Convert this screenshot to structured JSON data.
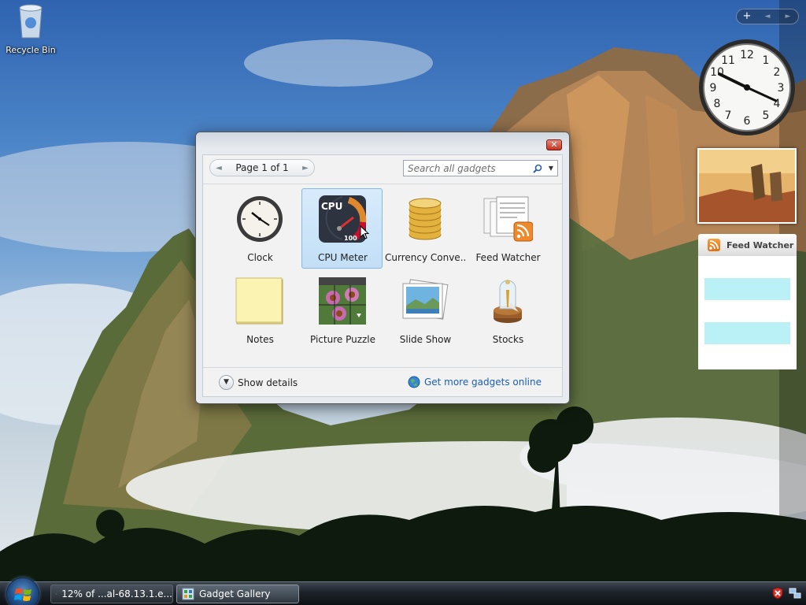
{
  "desktop": {
    "recycle_bin_label": "Recycle Bin"
  },
  "sidebar": {
    "controls": {
      "add_label": "+",
      "prev_label": "◄",
      "next_label": "►"
    },
    "feed_watcher": {
      "title": "Feed Watcher"
    }
  },
  "gallery": {
    "close_label": "✕",
    "pager": {
      "label": "Page 1 of 1",
      "prev_icon": "◄",
      "next_icon": "►"
    },
    "search": {
      "placeholder": "Search all gadgets"
    },
    "gadgets": [
      {
        "label": "Clock",
        "icon": "clock-icon"
      },
      {
        "label": "CPU Meter",
        "icon": "cpu-meter-icon",
        "selected": true
      },
      {
        "label": "Currency Conve...",
        "icon": "currency-coins-icon"
      },
      {
        "label": "Feed Watcher",
        "icon": "feed-watcher-icon"
      },
      {
        "label": "Notes",
        "icon": "notes-icon"
      },
      {
        "label": "Picture Puzzle",
        "icon": "picture-puzzle-icon"
      },
      {
        "label": "Slide Show",
        "icon": "slide-show-icon"
      },
      {
        "label": "Stocks",
        "icon": "stocks-icon"
      }
    ],
    "cpu_icon_text": {
      "title": "CPU",
      "value": "100"
    },
    "show_details_label": "Show details",
    "get_more_label": "Get more gadgets online"
  },
  "taskbar": {
    "tasks": [
      {
        "label": "12% of ...al-68.13.1.e...",
        "icon": "ie-icon",
        "active": false
      },
      {
        "label": "Gadget Gallery",
        "icon": "gadget-gallery-icon",
        "active": true
      }
    ]
  },
  "colors": {
    "selection_bg": "#c2dff7",
    "link": "#1a5fb4",
    "feed_row": "#b9f1f6"
  }
}
